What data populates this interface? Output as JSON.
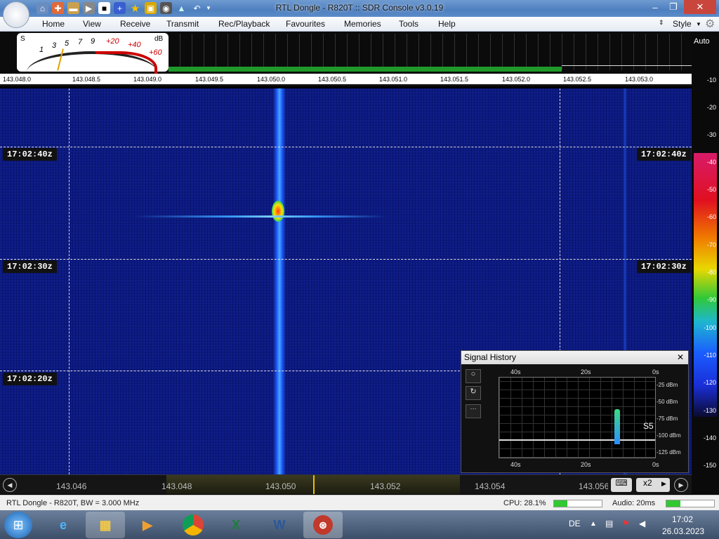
{
  "window": {
    "title": "RTL Dongle - R820T :: SDR Console v3.0.19"
  },
  "menu": [
    "Home",
    "View",
    "Receive",
    "Transmit",
    "Rec/Playback",
    "Favourites",
    "Memories",
    "Tools",
    "Help"
  ],
  "style_label": "Style",
  "smeter": {
    "s_label": "S",
    "db_label": "dB",
    "ticks": [
      "1",
      "3",
      "5",
      "7",
      "9",
      "+20",
      "+40",
      "+60"
    ]
  },
  "freq_ticks": [
    "143.048.0",
    "143.048.5",
    "143.049.0",
    "143.049.5",
    "143.050.0",
    "143.050.5",
    "143.051.0",
    "143.051.5",
    "143.052.0",
    "143.052.5",
    "143.053.0"
  ],
  "scale": {
    "auto": "Auto",
    "ticks": [
      "-10",
      "-20",
      "-30",
      "-40",
      "-50",
      "-60",
      "-70",
      "-80",
      "-90",
      "-100",
      "-110",
      "-120",
      "-130",
      "-140",
      "-150"
    ]
  },
  "timestamps": [
    "17:02:40z",
    "17:02:30z",
    "17:02:20z"
  ],
  "bottom_freqs": [
    "143.046",
    "143.048",
    "143.050",
    "143.052",
    "143.054",
    "143.056"
  ],
  "zoom_label": "x2",
  "signal_history": {
    "title": "Signal History",
    "top_labels": [
      "40s",
      "20s",
      "0s"
    ],
    "bottom_labels": [
      "40s",
      "20s",
      "0s"
    ],
    "db_labels": [
      "-25 dBm",
      "-50 dBm",
      "-75 dBm",
      "-100 dBm",
      "-125 dBm"
    ],
    "s_reading": "S5"
  },
  "status": {
    "device": "RTL Dongle - R820T, BW = 3.000 MHz",
    "cpu": "CPU: 28.1%",
    "cpu_fill": 0.28,
    "audio": "Audio: 20ms",
    "audio_fill": 0.3
  },
  "tray": {
    "lang": "DE",
    "time": "17:02",
    "date": "26.03.2023"
  }
}
